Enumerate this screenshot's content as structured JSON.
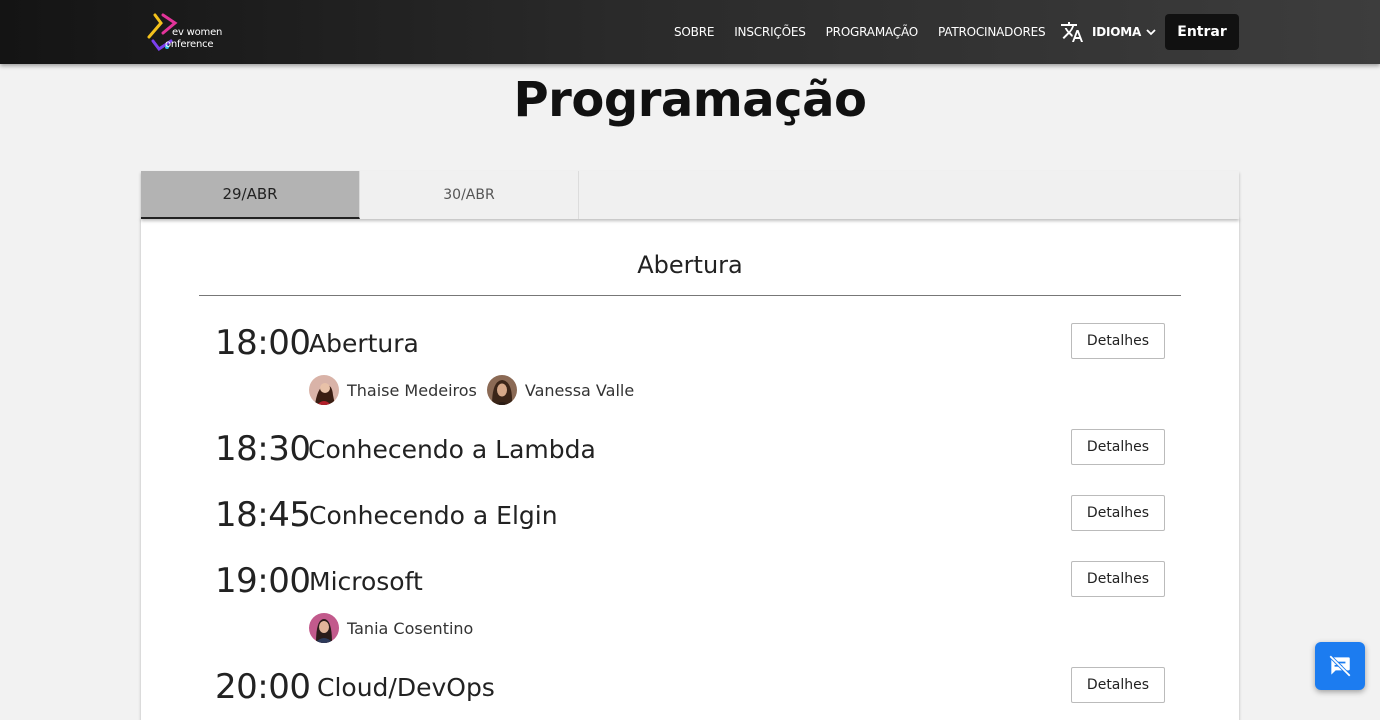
{
  "header": {
    "logo_line1": "ev women",
    "logo_line2": "onference",
    "nav": [
      "SOBRE",
      "INSCRIÇÕES",
      "PROGRAMAÇÃO",
      "PATROCINADORES"
    ],
    "language_label": "IDIOMA",
    "login_label": "Entrar"
  },
  "page": {
    "title": "Programação"
  },
  "tabs": [
    {
      "label": "29/ABR",
      "active": true
    },
    {
      "label": "30/ABR",
      "active": false
    }
  ],
  "schedule": {
    "section_title": "Abertura",
    "details_label": "Detalhes",
    "sessions": [
      {
        "time": "18:00",
        "title": "Abertura",
        "speakers": [
          "Thaise Medeiros",
          "Vanessa Valle"
        ]
      },
      {
        "time": "18:30",
        "title": "Conhecendo a Lambda",
        "speakers": []
      },
      {
        "time": "18:45",
        "title": "Conhecendo a Elgin",
        "speakers": []
      },
      {
        "time": "19:00",
        "title": "Microsoft",
        "speakers": [
          "Tania Cosentino"
        ]
      },
      {
        "time": "20:00",
        "title": "Cloud/DevOps",
        "speakers": []
      }
    ]
  },
  "icons": {
    "translate": "translate-icon",
    "chevron": "chevron-down-icon",
    "chat": "chat-off-icon"
  },
  "colors": {
    "header_bg": "#1a1a1a",
    "active_tab_bg": "#b3b3b3",
    "chat_button": "#1c7cf0"
  }
}
